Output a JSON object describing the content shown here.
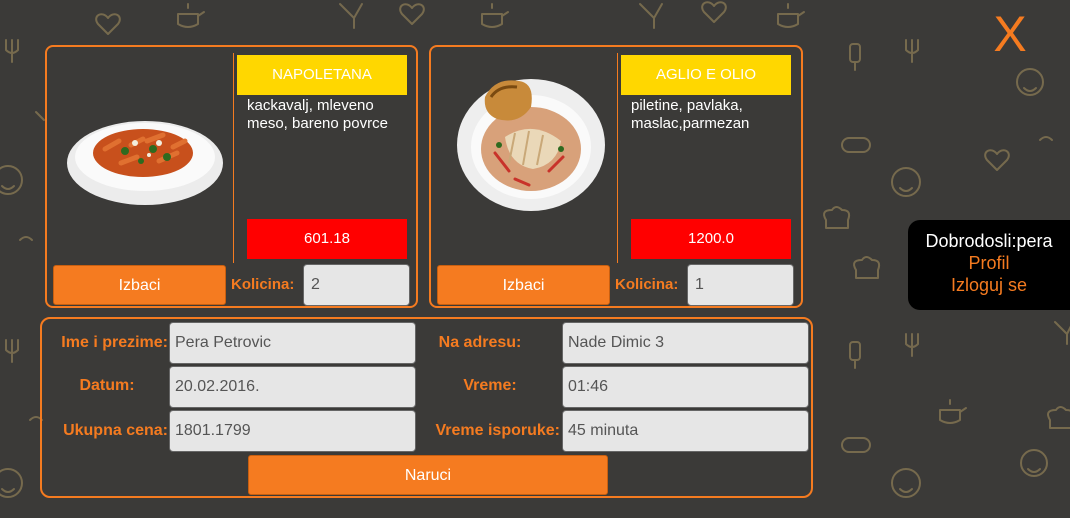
{
  "icons": {
    "close": "close-x-icon"
  },
  "close_label": "X",
  "cart_items": [
    {
      "title": "NAPOLETANA",
      "description": "kackavalj, mleveno meso, bareno povrce",
      "price": "601.18",
      "remove_label": "Izbaci",
      "quantity_label": "Kolicina:",
      "quantity": "2",
      "image": "penne-pasta-dish"
    },
    {
      "title": "AGLIO E OLIO",
      "description": "piletine, pavlaka, maslac,parmezan",
      "price": "1200.0",
      "remove_label": "Izbaci",
      "quantity_label": "Kolicina:",
      "quantity": "1",
      "image": "chicken-pasta-dish"
    }
  ],
  "order": {
    "name_label": "Ime i prezime:",
    "name_value": "Pera Petrovic",
    "address_label": "Na adresu:",
    "address_value": "Nade Dimic 3",
    "date_label": "Datum:",
    "date_value": "20.02.2016.",
    "time_label": "Vreme:",
    "time_value": "01:46",
    "total_label": "Ukupna cena:",
    "total_value": "1801.1799",
    "delivery_label": "Vreme isporuke:",
    "delivery_value": "45 minuta",
    "submit_label": "Naruci"
  },
  "user": {
    "welcome": "Dobrodosli:pera",
    "profile_label": "Profil",
    "logout_label": "Izloguj se"
  },
  "colors": {
    "accent": "#f57b20",
    "title_bg": "#ffd700",
    "price_bg": "#ff0000",
    "background": "#3b3a38"
  }
}
